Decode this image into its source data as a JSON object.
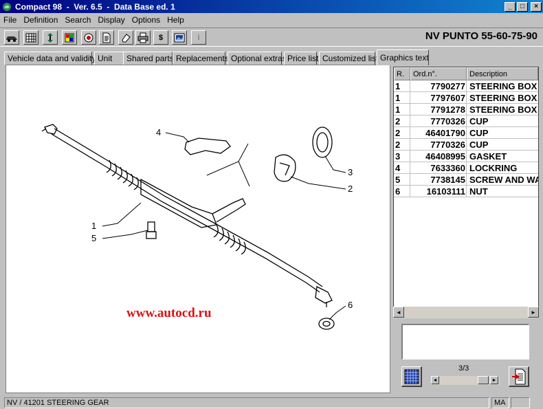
{
  "window": {
    "title": "Compact 98  -  Ver. 6.5  -  Data Base ed. 1",
    "minimize_glyph": "_",
    "maximize_glyph": "□",
    "close_glyph": "×"
  },
  "menu": [
    "File",
    "Definition",
    "Search",
    "Display",
    "Options",
    "Help"
  ],
  "toolbar": {
    "icons": [
      "car-icon",
      "grid-icon",
      "sort-icon",
      "palette-icon",
      "target-icon",
      "document-icon",
      "eraser-icon",
      "printer-icon",
      "dollar-icon",
      "image-icon",
      "info-icon"
    ],
    "dollar_label": "$",
    "info_label": "i"
  },
  "vehicle_title": "NV PUNTO 55-60-75-90",
  "tabs": [
    "Vehicle data and validity",
    "Unit",
    "Shared parts",
    "Replacements",
    "Optional extras",
    "Price list",
    "Customized lists",
    "Graphics text"
  ],
  "active_tab": "Graphics text",
  "drawing": {
    "callouts": [
      "1",
      "2",
      "3",
      "4",
      "5",
      "6"
    ],
    "watermark": "www.autocd.ru"
  },
  "parts_table": {
    "headers": [
      "R.",
      "Ord.n°.",
      "Description"
    ],
    "rows": [
      {
        "ref": "1",
        "order": "7790277",
        "desc": "STEERING BOX"
      },
      {
        "ref": "1",
        "order": "7797607",
        "desc": "STEERING BOX"
      },
      {
        "ref": "1",
        "order": "7791278",
        "desc": "STEERING BOX"
      },
      {
        "ref": "2",
        "order": "7770326",
        "desc": "CUP"
      },
      {
        "ref": "2",
        "order": "46401790",
        "desc": "CUP"
      },
      {
        "ref": "2",
        "order": "7770326",
        "desc": "CUP"
      },
      {
        "ref": "3",
        "order": "46408995",
        "desc": "GASKET"
      },
      {
        "ref": "4",
        "order": "7633360",
        "desc": "LOCKRING"
      },
      {
        "ref": "5",
        "order": "7738145",
        "desc": "SCREW AND WASHER"
      },
      {
        "ref": "6",
        "order": "16103111",
        "desc": "NUT"
      }
    ]
  },
  "pagination": {
    "label": "3/3",
    "current": 3,
    "total": 3
  },
  "status": {
    "path": "NV / 41201  STEERING GEAR",
    "mode": "MA"
  }
}
